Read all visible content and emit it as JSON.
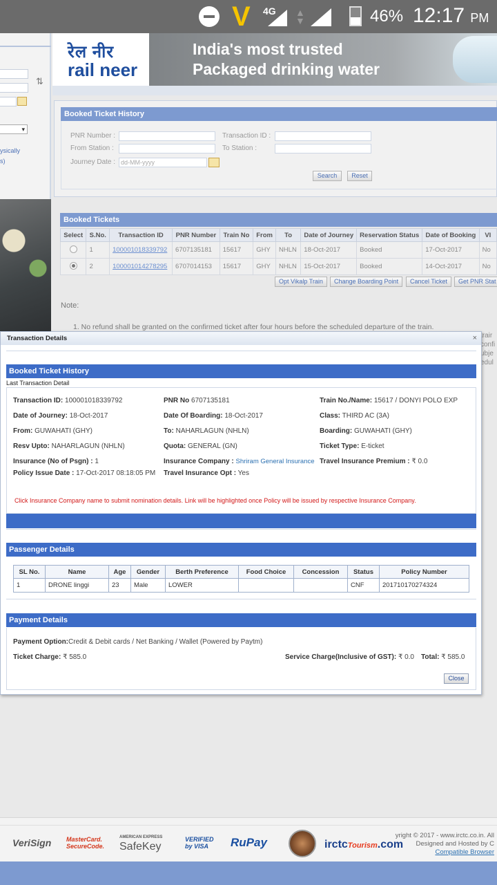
{
  "status_bar": {
    "network": "4G",
    "battery": "46%",
    "time": "12:17",
    "ampm": "PM"
  },
  "sidebar": {
    "text_line1": "ysically",
    "text_line2": "s)"
  },
  "banner": {
    "logo_hindi": "रेल नीर",
    "logo_english": "rail neer",
    "ad_line1": "India's most trusted",
    "ad_line2": "Packaged drinking water"
  },
  "search_panel": {
    "title": "Booked Ticket History",
    "pnr_label": "PNR Number :",
    "transaction_label": "Transaction ID :",
    "from_label": "From Station :",
    "to_label": "To Station :",
    "journey_label": "Journey Date :",
    "journey_placeholder": "dd-MM-yyyy",
    "search_btn": "Search",
    "reset_btn": "Reset"
  },
  "booked_tickets": {
    "title": "Booked Tickets",
    "columns": [
      "Select",
      "S.No.",
      "Transaction ID",
      "PNR Number",
      "Train No",
      "From",
      "To",
      "Date of Journey",
      "Reservation Status",
      "Date of Booking",
      "VI"
    ],
    "rows": [
      {
        "sno": "1",
        "txn": "100001018339792",
        "pnr": "6707135181",
        "train": "15617",
        "from": "GHY",
        "to": "NHLN",
        "doj": "18-Oct-2017",
        "status": "Booked",
        "dob": "17-Oct-2017",
        "vi": "No"
      },
      {
        "sno": "2",
        "txn": "100001014278295",
        "pnr": "6707014153",
        "train": "15617",
        "from": "GHY",
        "to": "NHLN",
        "doj": "15-Oct-2017",
        "status": "Booked",
        "dob": "14-Oct-2017",
        "vi": "No"
      }
    ],
    "actions": [
      "Opt Vikalp Train",
      "Change Boarding Point",
      "Cancel Ticket",
      "Get PNR Stat"
    ]
  },
  "note": {
    "label": "Note:",
    "item1": "1. No refund shall be granted on the confirmed ticket after four hours before the scheduled departure of the train.",
    "cut1": "trair",
    "cut2": "confi",
    "cut3": "ubje",
    "cut4": "edul"
  },
  "modal": {
    "title": "Transaction Details",
    "close_x": "×",
    "heading": "Booked Ticket History",
    "subheading": "Last Transaction Detail",
    "fields": {
      "txn_label": "Transaction ID:",
      "txn_value": "100001018339792",
      "pnr_label": "PNR No",
      "pnr_value": "6707135181",
      "train_label": "Train No./Name:",
      "train_value": "15617 /  DONYI POLO EXP",
      "doj_label": "Date of Journey:",
      "doj_value": "18-Oct-2017",
      "dob_label": "Date Of Boarding:",
      "dob_value": "18-Oct-2017",
      "class_label": "Class:",
      "class_value": "THIRD AC (3A)",
      "from_label": "From:",
      "from_value": "GUWAHATI (GHY)",
      "to_label": "To:",
      "to_value": "NAHARLAGUN (NHLN)",
      "boarding_label": "Boarding:",
      "boarding_value": "GUWAHATI (GHY)",
      "resv_label": "Resv Upto:",
      "resv_value": "NAHARLAGUN (NHLN)",
      "quota_label": "Quota:",
      "quota_value": "GENERAL (GN)",
      "ticket_type_label": "Ticket Type:",
      "ticket_type_value": "E-ticket",
      "insurance_label": "Insurance (No of Psgn) :",
      "insurance_value": "1",
      "ins_company_label": "Insurance Company :",
      "ins_company_value": "Shriram General Insurance",
      "premium_label": "Travel Insurance Premium :",
      "premium_value": "₹ 0.0",
      "policy_date_label": "Policy Issue Date :",
      "policy_date_value": "17-Oct-2017 08:18:05 PM",
      "ins_opt_label": "Travel Insurance Opt :",
      "ins_opt_value": "Yes"
    },
    "red_note": "Click Insurance Company name to submit nomination details. Link will be highlighted once Policy will be issued by respective Insurance Company.",
    "passenger_heading": "Passenger Details",
    "passenger_columns": [
      "SL No.",
      "Name",
      "Age",
      "Gender",
      "Berth Preference",
      "Food Choice",
      "Concession",
      "Status",
      "Policy Number"
    ],
    "passengers": [
      {
        "sl": "1",
        "name": "DRONE linggi",
        "age": "23",
        "gender": "Male",
        "berth": "LOWER",
        "food": "",
        "concession": "",
        "status": "CNF",
        "policy": "201710170274324"
      }
    ],
    "payment_heading": "Payment Details",
    "payment_option_label": "Payment Option:",
    "payment_option_value": "Credit & Debit cards / Net Banking / Wallet (Powered by Paytm)",
    "ticket_charge_label": "Ticket Charge:",
    "ticket_charge_value": "₹ 585.0",
    "service_charge_label": "Service Charge(Inclusive of GST):",
    "service_charge_value": "₹ 0.0",
    "total_label": "Total:",
    "total_value": "₹ 585.0",
    "close_btn": "Close"
  },
  "footer": {
    "verisign": "VeriSign",
    "mastercard_1": "MasterCard.",
    "mastercard_2": "SecureCode.",
    "amex_1": "AMERICAN EXPRESS",
    "amex_2": "SafeKey",
    "visa_1": "VERIFIED",
    "visa_2": "by VISA",
    "rupay": "RuPay",
    "irctc": "irctc",
    "irctc_dot": ".com",
    "tourism": "Tourism",
    "copy_1": "yright © 2017 - www.irctc.co.in. All",
    "copy_2": "Designed and Hosted by C",
    "copy_3": "Compatible Browser"
  }
}
